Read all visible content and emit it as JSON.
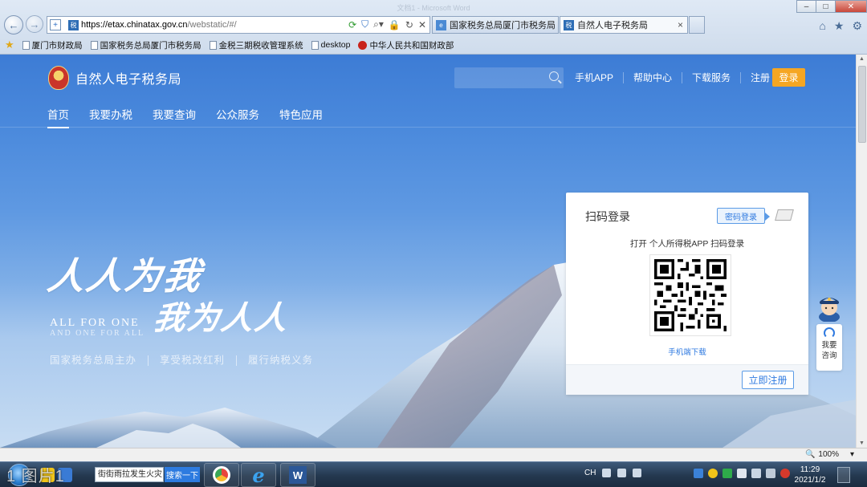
{
  "browser": {
    "window_title": "文档1 - Microsoft Word",
    "address_host": "https://etax.chinatax.gov.cn",
    "address_path": "/webstatic/#/",
    "tabs": [
      {
        "label": "国家税务总局厦门市税务局",
        "active": false
      },
      {
        "label": "自然人电子税务局",
        "active": true
      }
    ],
    "favorites": [
      {
        "label": "厦门市财政局"
      },
      {
        "label": "国家税务总局厦门市税务局"
      },
      {
        "label": "金税三期税收管理系统"
      },
      {
        "label": "desktop"
      },
      {
        "label": "中华人民共和国财政部"
      }
    ],
    "zoom": "100%"
  },
  "site": {
    "title": "自然人电子税务局",
    "search_placeholder": "",
    "top_links": [
      "手机APP",
      "帮助中心",
      "下载服务",
      "注册"
    ],
    "login_label": "登录",
    "nav": [
      {
        "label": "首页",
        "active": true
      },
      {
        "label": "我要办税",
        "active": false
      },
      {
        "label": "我要查询",
        "active": false
      },
      {
        "label": "公众服务",
        "active": false
      },
      {
        "label": "特色应用",
        "active": false
      }
    ]
  },
  "hero": {
    "slogan_line1": "人人为我",
    "slogan_line2": "我为人人",
    "english_line1": "ALL FOR ONE",
    "english_line2": "AND ONE FOR ALL",
    "subtitles": [
      "国家税务总局主办",
      "享受税改红利",
      "履行纳税义务"
    ]
  },
  "login_panel": {
    "title": "扫码登录",
    "password_login": "密码登录",
    "scan_hint": "打开 个人所得税APP 扫码登录",
    "download_link": "手机端下载",
    "register": "立即注册"
  },
  "help": {
    "label": "我要咨询"
  },
  "taskbar": {
    "search_text": "街街雨拉发生火灾",
    "search_button": "搜索一下",
    "lang": "CH",
    "time": "11:29",
    "date": "2021/1/2",
    "watermark": "1 图片1"
  },
  "colors": {
    "brand_blue": "#3d7cd5",
    "accent_orange": "#f5a623",
    "link_blue": "#2f7ae0"
  }
}
